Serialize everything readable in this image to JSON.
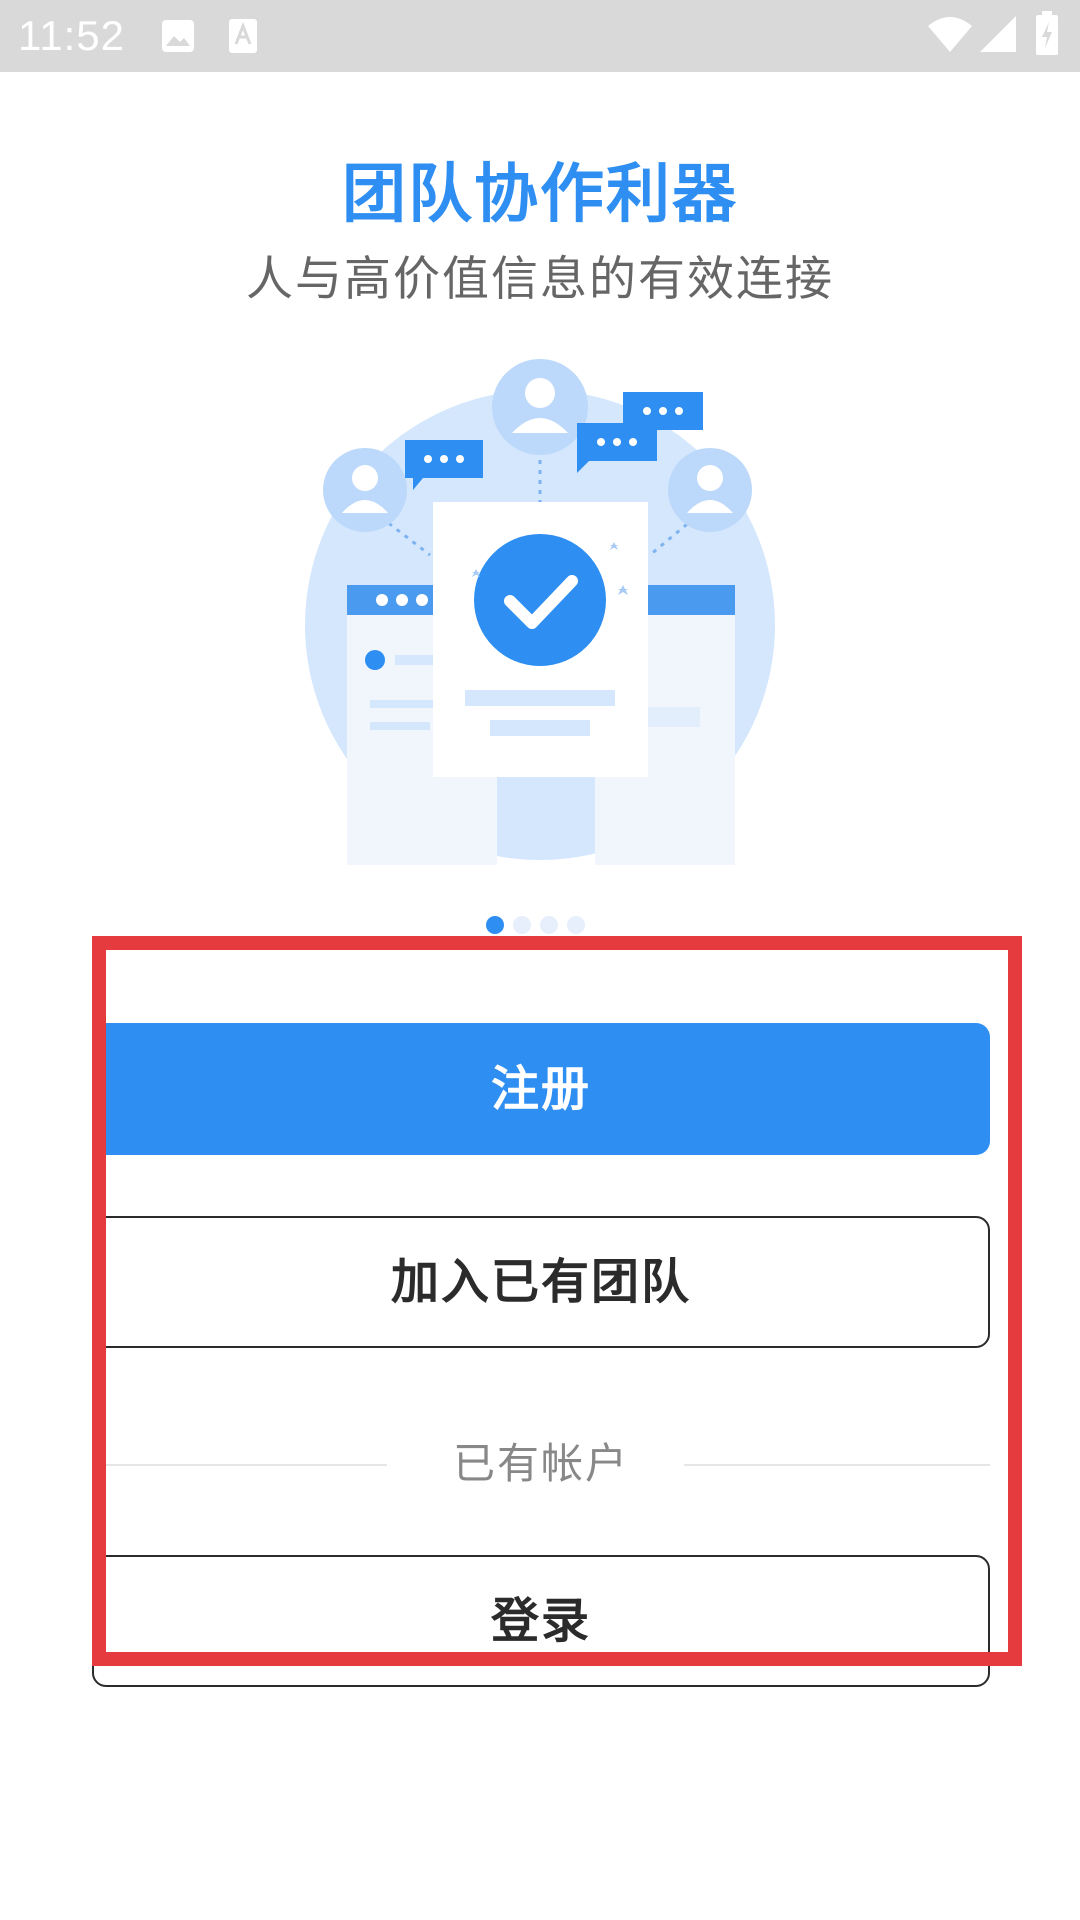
{
  "status_bar": {
    "time": "11:52",
    "icons": [
      "image-icon",
      "font-icon",
      "wifi-icon",
      "cell-signal-icon",
      "battery-charging-icon"
    ]
  },
  "hero": {
    "title": "团队协作利器",
    "subtitle": "人与高价值信息的有效连接"
  },
  "pager": {
    "count": 4,
    "active_index": 0
  },
  "actions": {
    "register_label": "注册",
    "join_team_label": "加入已有团队",
    "divider_text": "已有帐户",
    "login_label": "登录"
  },
  "colors": {
    "accent": "#2e8ef2",
    "highlight": "#e53b3e",
    "status_bar": "#d9d9d9"
  }
}
